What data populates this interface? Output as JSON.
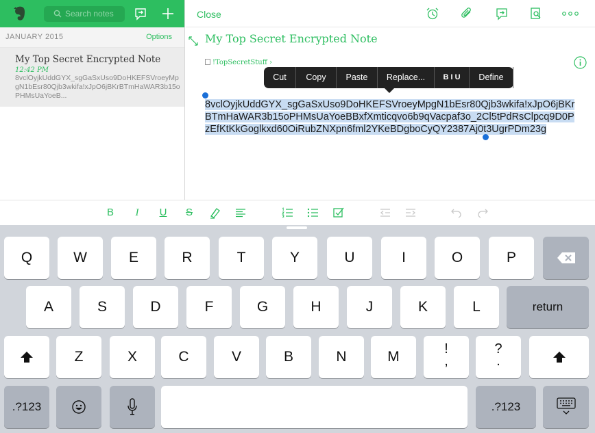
{
  "sidebar": {
    "search_placeholder": "Search notes",
    "section_date": "JANUARY 2015",
    "options_label": "Options",
    "note": {
      "title": "My Top Secret Encrypted Note",
      "time": "12:42 PM",
      "snippet": "8vclOyjkUddGYX_sgGaSxUso9DoHKEFSVroeyMpgN1bEsr80Qjb3wkifa!xJpO6jBKrBTmHaWAR3b15oPHMsUaYoeB..."
    }
  },
  "editor": {
    "close_label": "Close",
    "note_title": "My Top Secret Encrypted Note",
    "notebook": "!TopSecretStuff",
    "notebook_chevron": "›",
    "body_text": "8vclOyjkUddGYX_sgGaSxUso9DoHKEFSVroeyMpgN1bEsr80Qjb3wkifa!xJpO6jBKrBTmHaWAR3b15oPHMsUaYoeBBxfXmticqvo6b9qVacpaf3o_2Cl5tPdRsClpcq9D0PzEfKtKkGoglkxd60OiRubZNXpn6fml2YKeBDgboCyQY2387Aj0t3UgrPDm23g",
    "edit_menu": [
      "Cut",
      "Copy",
      "Paste",
      "Replace...",
      "B I U",
      "Define"
    ]
  },
  "format_toolbar": {
    "bold": "B",
    "italic": "I",
    "underline": "U",
    "strike": "S"
  },
  "keyboard": {
    "row1": [
      "Q",
      "W",
      "E",
      "R",
      "T",
      "Y",
      "U",
      "I",
      "O",
      "P"
    ],
    "row2": [
      "A",
      "S",
      "D",
      "F",
      "G",
      "H",
      "J",
      "K",
      "L"
    ],
    "row3": [
      "Z",
      "X",
      "C",
      "V",
      "B",
      "N",
      "M"
    ],
    "punct1": {
      "top": "!",
      "bottom": ","
    },
    "punct2": {
      "top": "?",
      "bottom": "."
    },
    "return_label": "return",
    "numbers_label": ".?123",
    "space_label": ""
  },
  "colors": {
    "accent": "#2dbe60",
    "selection": "#c8dcf2",
    "menu": "#222222",
    "keyboard_bg": "#d1d5db"
  }
}
